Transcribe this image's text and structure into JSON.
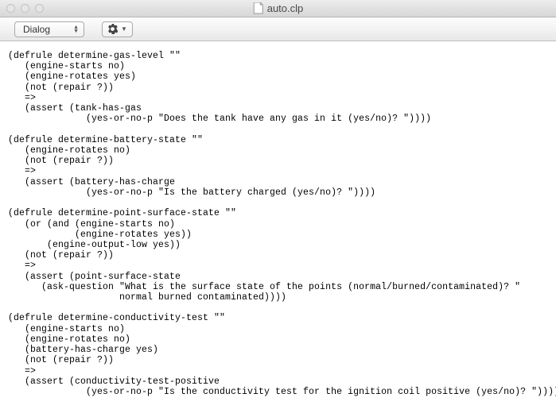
{
  "window": {
    "title": "auto.clp"
  },
  "toolbar": {
    "select_label": "Dialog"
  },
  "editor": {
    "content": "(defrule determine-gas-level \"\"\n   (engine-starts no)\n   (engine-rotates yes)\n   (not (repair ?))\n   =>\n   (assert (tank-has-gas\n              (yes-or-no-p \"Does the tank have any gas in it (yes/no)? \"))))\n\n(defrule determine-battery-state \"\"\n   (engine-rotates no)\n   (not (repair ?))\n   =>\n   (assert (battery-has-charge\n              (yes-or-no-p \"Is the battery charged (yes/no)? \"))))\n\n(defrule determine-point-surface-state \"\"\n   (or (and (engine-starts no)\n            (engine-rotates yes))\n       (engine-output-low yes))\n   (not (repair ?))\n   =>\n   (assert (point-surface-state\n      (ask-question \"What is the surface state of the points (normal/burned/contaminated)? \"\n                    normal burned contaminated))))\n\n(defrule determine-conductivity-test \"\"\n   (engine-starts no)\n   (engine-rotates no)\n   (battery-has-charge yes)\n   (not (repair ?))\n   =>\n   (assert (conductivity-test-positive\n              (yes-or-no-p \"Is the conductivity test for the ignition coil positive (yes/no)? \"))))"
  }
}
